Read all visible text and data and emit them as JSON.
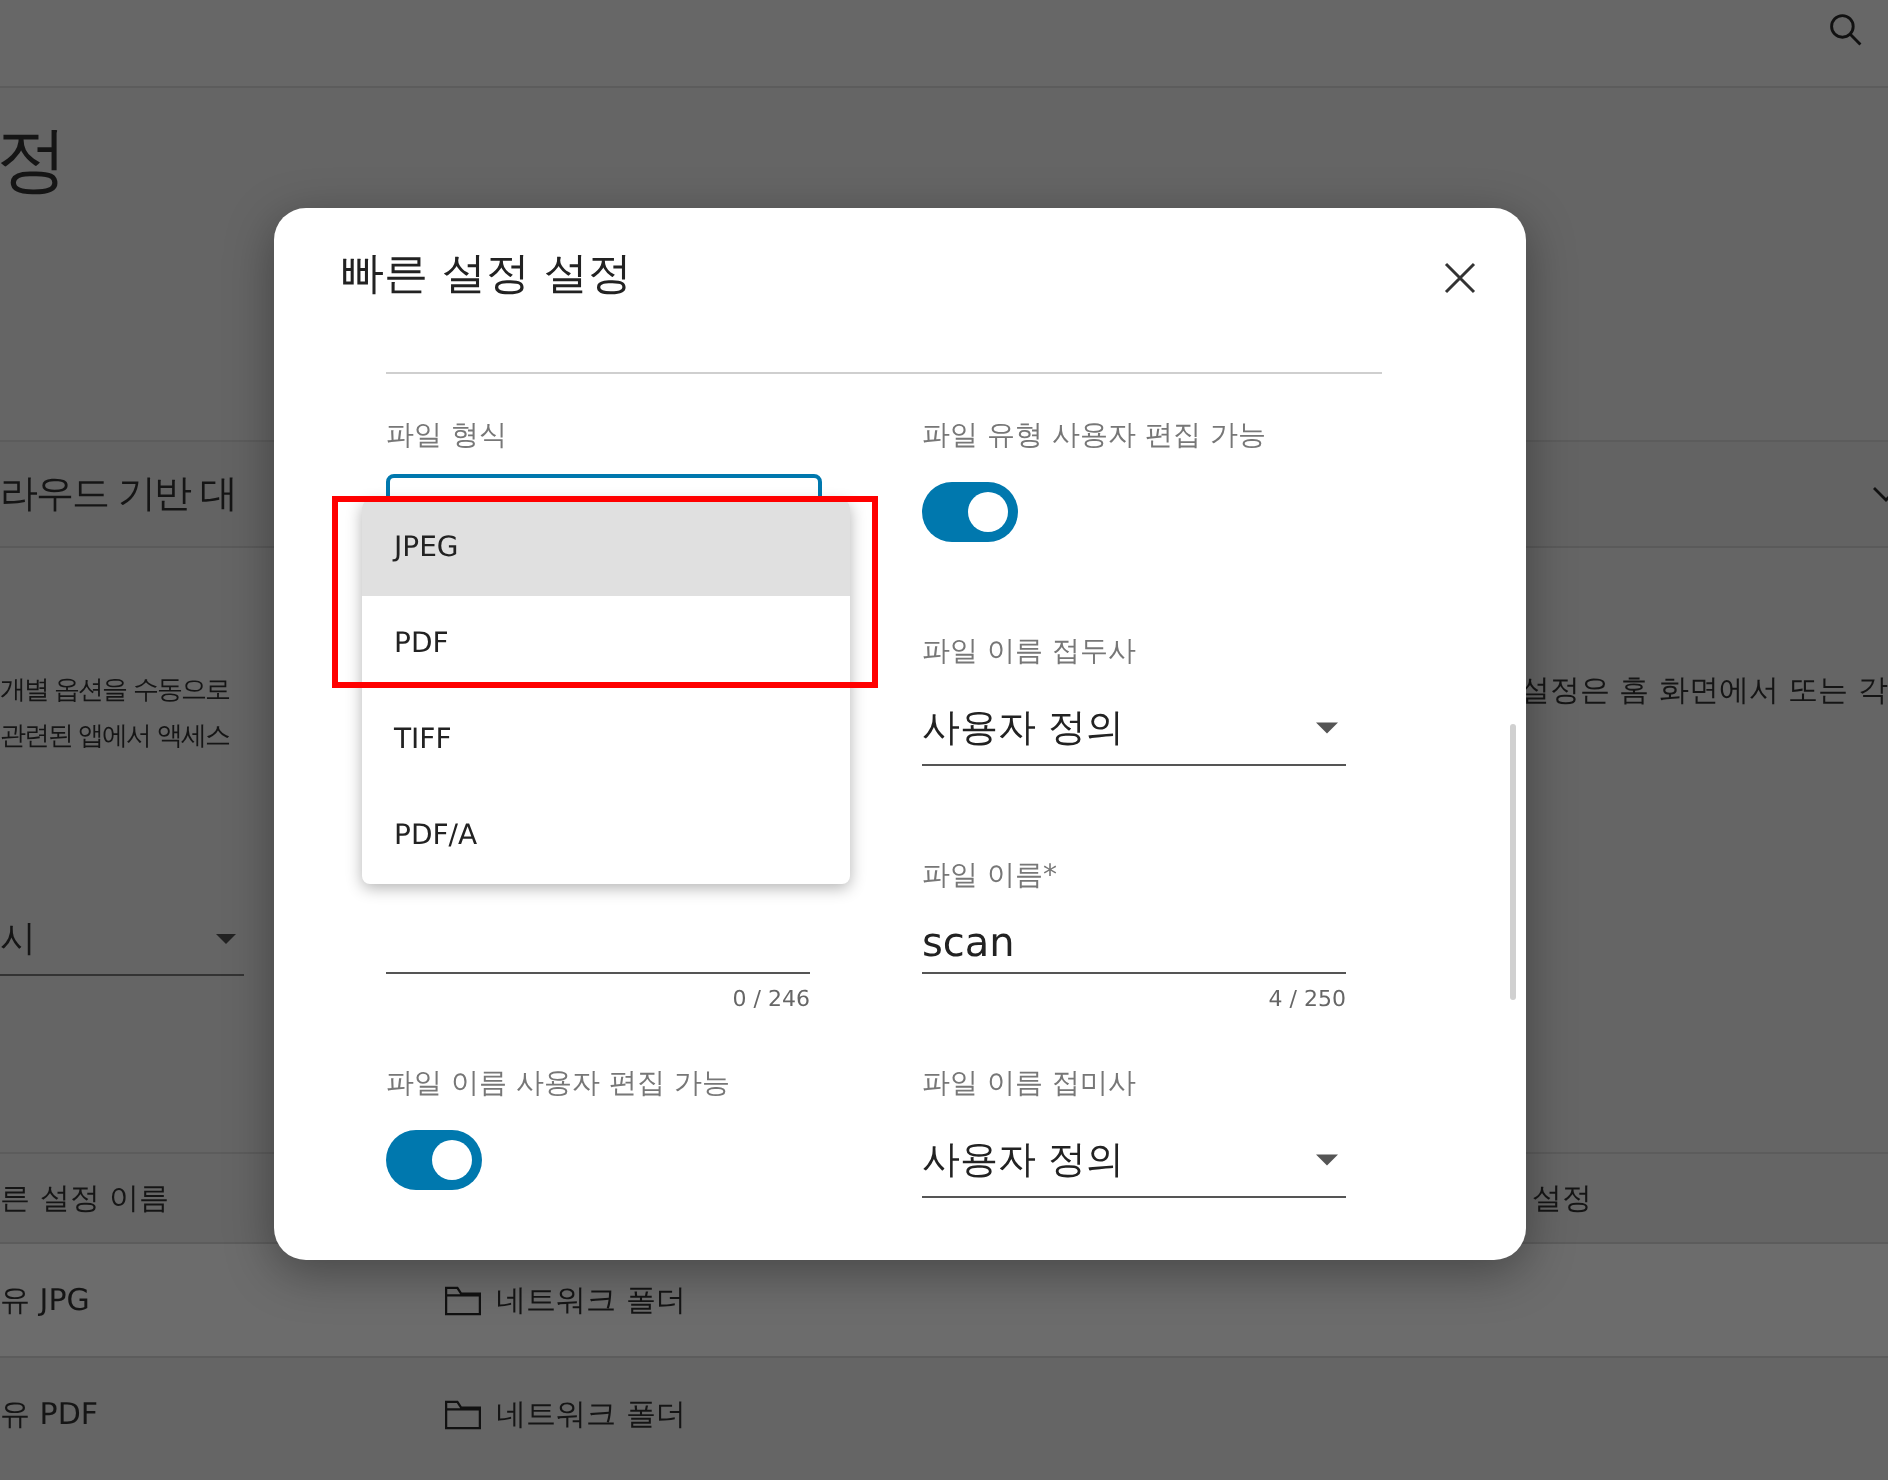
{
  "background": {
    "title": "정",
    "section": "라우드 기반 대",
    "description_left": [
      "개별 옵션을 수동으로",
      "관련된 앱에서 액세스"
    ],
    "description_right": "설정은 홈 화면에서 또는 각",
    "filter": {
      "value": "시"
    },
    "table": {
      "columns": [
        "른 설정 이름",
        "설정"
      ],
      "rows": [
        {
          "name": "유 JPG",
          "destination": "네트워크 폴더"
        },
        {
          "name": "유 PDF",
          "destination": "네트워크 폴더"
        }
      ]
    }
  },
  "dialog": {
    "title": "빠른 설정 설정",
    "rows": [
      {
        "left": {
          "kind": "select",
          "label": "파일 형식",
          "open": true,
          "options": [
            {
              "label": "JPEG",
              "selected": true
            },
            {
              "label": "PDF",
              "selected": false
            },
            {
              "label": "TIFF",
              "selected": false
            },
            {
              "label": "PDF/A",
              "selected": false
            }
          ]
        },
        "right": {
          "kind": "toggle",
          "label": "파일 유형 사용자 편집 가능",
          "on": true
        }
      },
      {
        "right": {
          "kind": "select",
          "label": "파일 이름 접두사",
          "value": "사용자 정의"
        }
      },
      {
        "left": {
          "kind": "text",
          "counter": "0 / 246"
        },
        "right": {
          "kind": "text",
          "label": "파일 이름*",
          "value": "scan",
          "counter": "4 / 250"
        }
      },
      {
        "left": {
          "kind": "toggle",
          "label": "파일 이름 사용자 편집 가능",
          "on": true
        },
        "right": {
          "kind": "select",
          "label": "파일 이름 접미사",
          "value": "사용자 정의"
        }
      }
    ]
  }
}
